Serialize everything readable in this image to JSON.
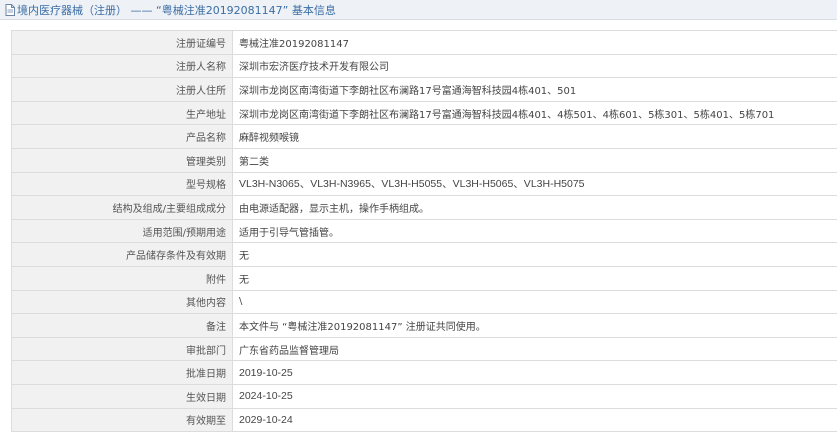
{
  "header": {
    "title": "境内医疗器械（注册） —— “粤械注准20192081147” 基本信息",
    "icon": "document-icon"
  },
  "rows": [
    {
      "label": "注册证编号",
      "value": "粤械注准20192081147"
    },
    {
      "label": "注册人名称",
      "value": "深圳市宏济医疗技术开发有限公司"
    },
    {
      "label": "注册人住所",
      "value": "深圳市龙岗区南湾街道下李朗社区布澜路17号富通海智科技园4栋401、501"
    },
    {
      "label": "生产地址",
      "value": "深圳市龙岗区南湾街道下李朗社区布澜路17号富通海智科技园4栋401、4栋501、4栋601、5栋301、5栋401、5栋701"
    },
    {
      "label": "产品名称",
      "value": "麻醉视频喉镜"
    },
    {
      "label": "管理类别",
      "value": "第二类"
    },
    {
      "label": "型号规格",
      "value": "VL3H-N3065、VL3H-N3965、VL3H-H5055、VL3H-H5065、VL3H-H5075"
    },
    {
      "label": "结构及组成/主要组成成分",
      "value": "由电源适配器，显示主机，操作手柄组成。"
    },
    {
      "label": "适用范围/预期用途",
      "value": "适用于引导气管插管。"
    },
    {
      "label": "产品储存条件及有效期",
      "value": "无"
    },
    {
      "label": "附件",
      "value": "无"
    },
    {
      "label": "其他内容",
      "value": "\\"
    },
    {
      "label": "备注",
      "value": "本文件与 “粤械注准20192081147” 注册证共同使用。"
    },
    {
      "label": "审批部门",
      "value": "广东省药品监督管理局"
    },
    {
      "label": "批准日期",
      "value": "2019-10-25"
    },
    {
      "label": "生效日期",
      "value": "2024-10-25"
    },
    {
      "label": "有效期至",
      "value": "2029-10-24"
    }
  ]
}
